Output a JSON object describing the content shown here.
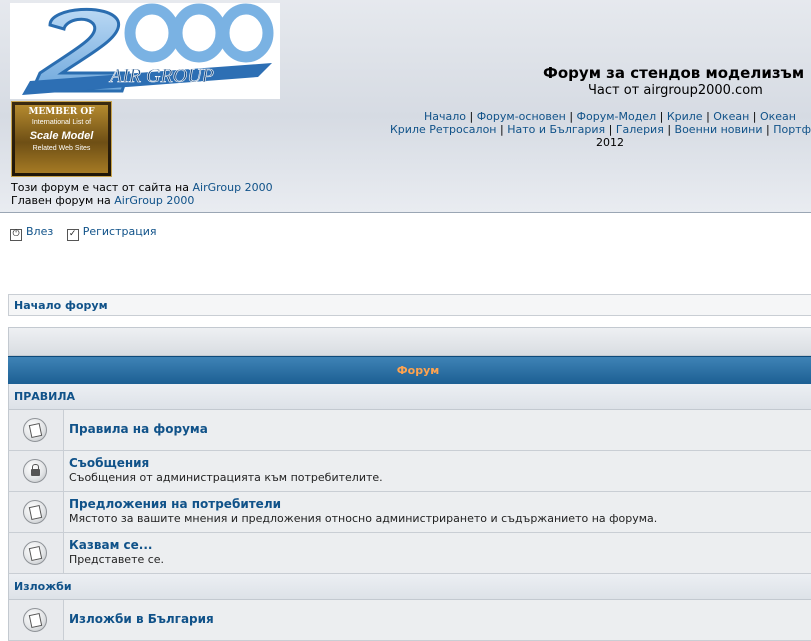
{
  "header": {
    "logo_text": "2000",
    "logo_sub": "AIR GROUP",
    "badge": {
      "line1": "MEMBER OF",
      "line2": "International List of",
      "line3": "Scale Model",
      "line4": "Related Web Sites"
    },
    "site_title": "Форум за стендов моделизъм",
    "site_subtitle": "Част от airgroup2000.com",
    "nav_row1": [
      "Начало",
      "Форум-основен",
      "Форум-Модел",
      "Криле",
      "Океан",
      "Океан"
    ],
    "nav_row2": [
      "Криле Ретросалон",
      "Нато и България",
      "Галерия",
      "Военни новини",
      "Портфолио"
    ],
    "nav_year": "2012",
    "info_line1_prefix": "Този форум е част от сайта на",
    "info_line1_link": "AirGroup 2000",
    "info_line2_prefix": "Главен форум на",
    "info_line2_link": "AirGroup 2000"
  },
  "login": {
    "login_label": "Влез",
    "register_label": "Регистрация"
  },
  "breadcrumb": {
    "label": "Начало форум"
  },
  "forum": {
    "header_label": "Форум",
    "categories": [
      {
        "name": "ПРАВИЛА",
        "forums": [
          {
            "title": "Правила на форума",
            "desc": "",
            "icon": "read-forum-icon"
          },
          {
            "title": "Съобщения",
            "desc": "Съобщения от администрацията към потребителите.",
            "icon": "locked-forum-icon"
          },
          {
            "title": "Предложения на потребители",
            "desc": "Мястото за вашите мнения и предложения относно администрирането и съдържанието на форума.",
            "icon": "read-forum-icon"
          },
          {
            "title": "Казвам се...",
            "desc": "Представете се.",
            "icon": "read-forum-icon"
          }
        ]
      },
      {
        "name": "Изложби",
        "forums": [
          {
            "title": "Изложби в България",
            "desc": "",
            "icon": "read-forum-icon"
          }
        ]
      }
    ]
  }
}
